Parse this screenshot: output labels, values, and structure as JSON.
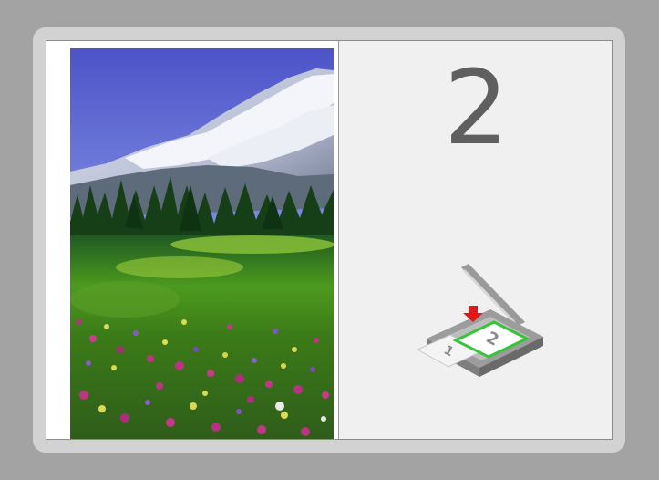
{
  "right_panel": {
    "step_number": "2"
  },
  "scanner_icon": {
    "page_labels": [
      "2",
      "1"
    ],
    "arrow_color": "#e01818",
    "highlight_color": "#35c43a"
  }
}
